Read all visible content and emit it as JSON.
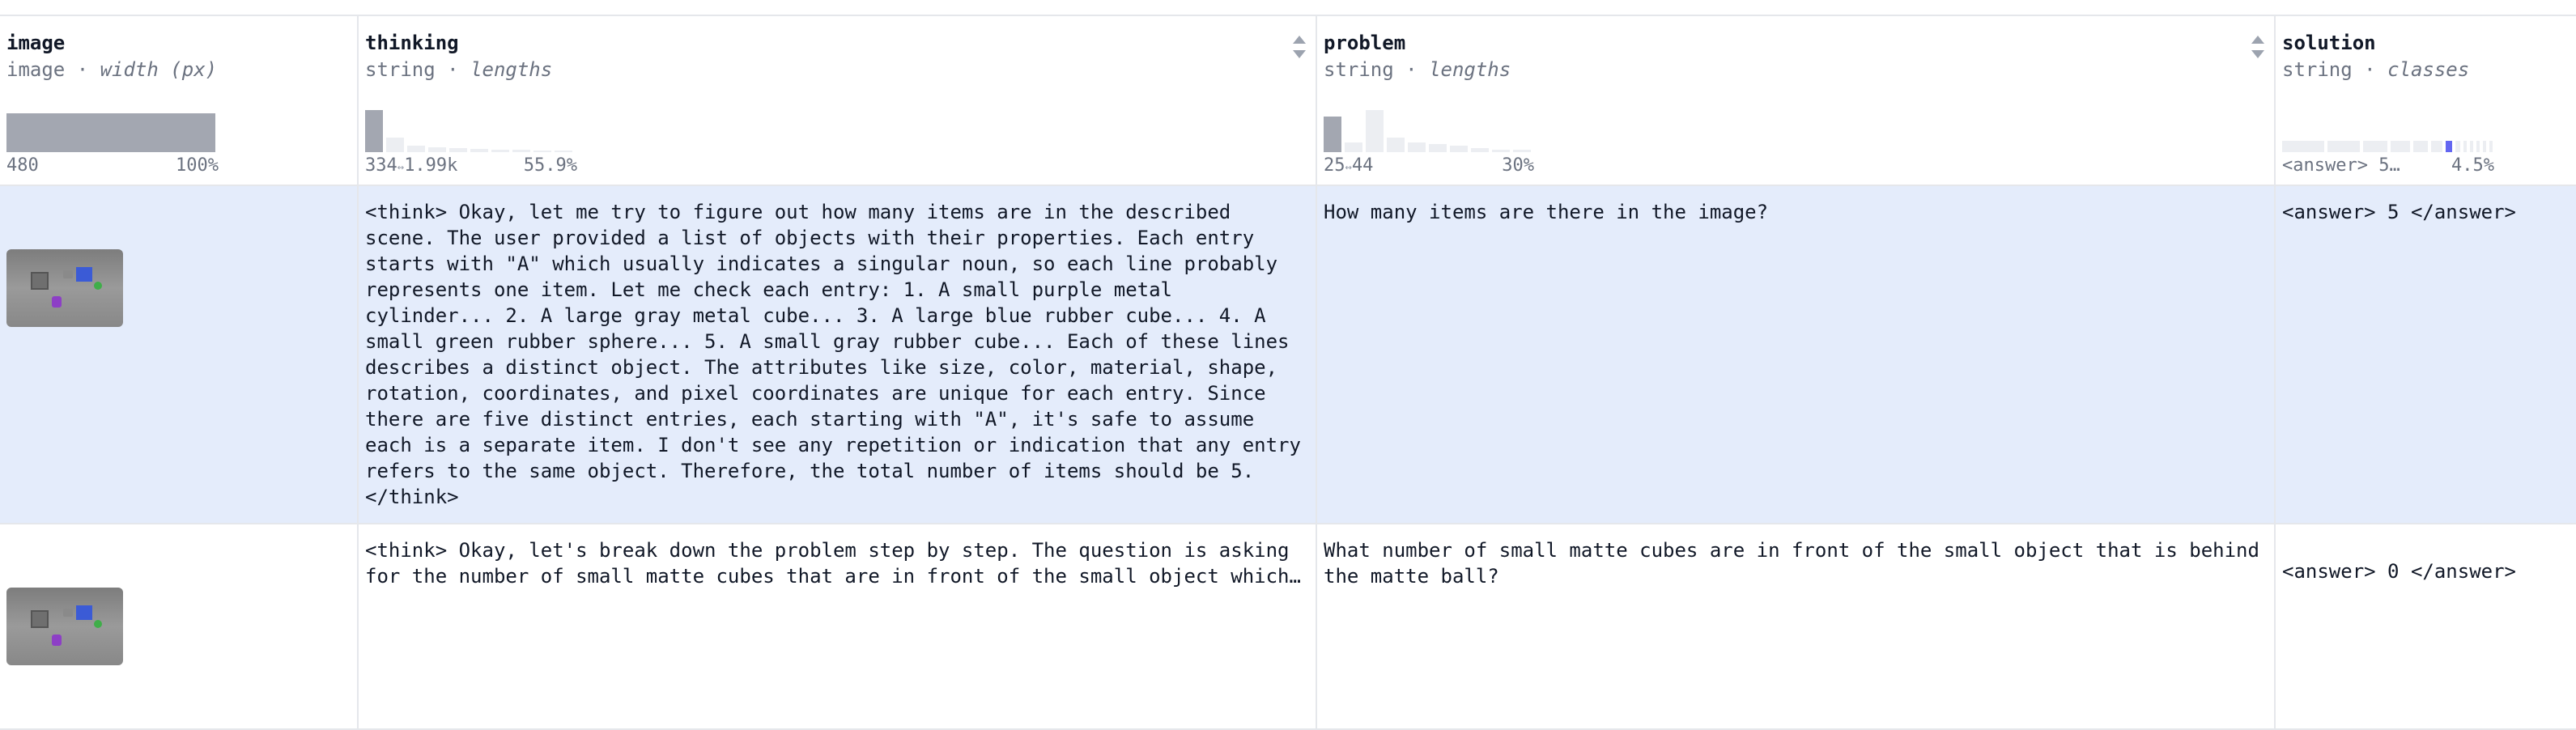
{
  "columns": [
    {
      "name": "image",
      "type": "image",
      "stat": "width (px)",
      "range_min": "480",
      "range_max": "100%"
    },
    {
      "name": "thinking",
      "type": "string",
      "stat": "lengths",
      "range_min": "334",
      "range_sep": "↔",
      "range_max": "1.99k",
      "pct": "55.9%"
    },
    {
      "name": "problem",
      "type": "string",
      "stat": "lengths",
      "range_min": "25",
      "range_sep": "↔",
      "range_max": "44",
      "pct": "30%"
    },
    {
      "name": "solution",
      "type": "string",
      "stat": "classes",
      "class_label": "<answer> 5…",
      "pct": "4.5%"
    }
  ],
  "type_sep": " · ",
  "rows": [
    {
      "thinking": "<think> Okay, let me try to figure out how many items are in the described scene. The user provided a list of objects with their properties. Each entry starts with \"A\" which usually indicates a singular noun, so each line probably represents one item. Let me check each entry: 1. A small purple metal cylinder... 2. A large gray metal cube... 3. A large blue rubber cube... 4. A small green rubber sphere... 5. A small gray rubber cube... Each of these lines describes a distinct object. The attributes like size, color, material, shape, rotation, coordinates, and pixel coordinates are unique for each entry. Since there are five distinct entries, each starting with \"A\", it's safe to assume each is a separate item. I don't see any repetition or indication that any entry refers to the same object. Therefore, the total number of items should be 5. </think>",
      "problem": "How many items are there in the image?",
      "solution": "<answer> 5 </answer>"
    },
    {
      "thinking": "<think> Okay, let's break down the problem step by step. The question is asking for the number of small matte cubes that are in front of the small object which is behind the matte ball?",
      "problem": "What number of small matte cubes are in front of the small object that is behind the matte ball?",
      "solution": "<answer> 0 </answer>"
    }
  ],
  "colors": {
    "row_highlight": "#e4ecfb",
    "bar": "#eceef2",
    "bar_dark": "#a3a7b1",
    "accent": "#6366f1"
  }
}
